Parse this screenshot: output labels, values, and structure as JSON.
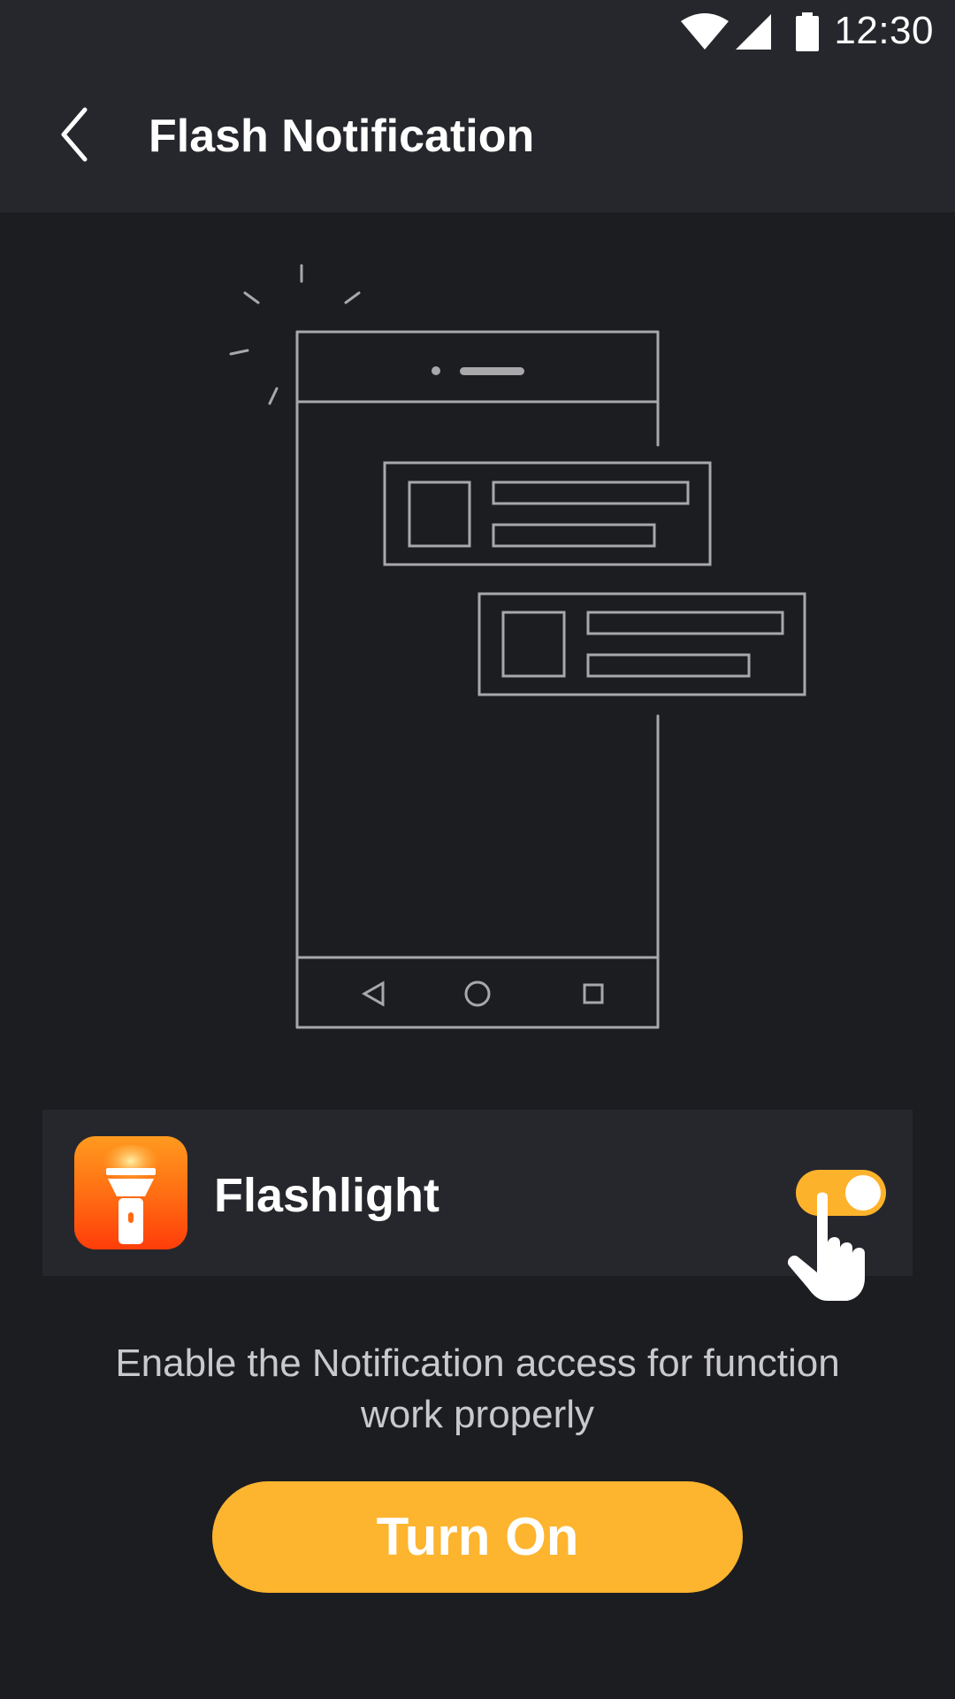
{
  "status_bar": {
    "time": "12:30",
    "icons": [
      "wifi-icon",
      "cellular-signal-icon",
      "battery-icon"
    ]
  },
  "app_bar": {
    "title": "Flash Notification",
    "back_icon": "chevron-left-icon"
  },
  "illustration": {
    "subject": "phone-with-notifications-illustration",
    "nav_icons": [
      "back-triangle-icon",
      "home-circle-icon",
      "recents-square-icon"
    ]
  },
  "permission_card": {
    "app_name": "Flashlight",
    "app_icon": "flashlight-app-icon",
    "toggle_state": "on"
  },
  "description": "Enable the Notification access for function work properly",
  "turn_on_button": {
    "label": "Turn On"
  },
  "colors": {
    "background": "#1c1d21",
    "bar": "#26272c",
    "accent": "#fdb42e",
    "text_primary": "#ffffff",
    "text_secondary": "#c9c9cc",
    "line_art": "#a8a8ab"
  }
}
